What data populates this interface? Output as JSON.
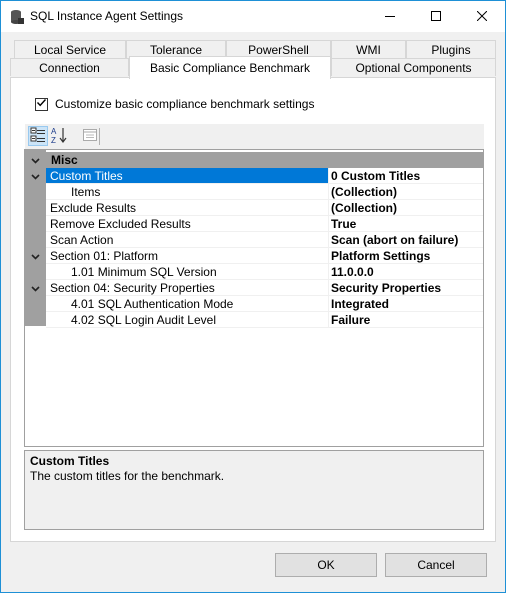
{
  "window": {
    "title": "SQL Instance Agent Settings"
  },
  "tabs": {
    "row1": [
      "Local Service",
      "Tolerance",
      "PowerShell",
      "WMI",
      "Plugins"
    ],
    "row2": [
      "Connection",
      "Basic Compliance Benchmark",
      "Optional Components"
    ],
    "active": "Basic Compliance Benchmark"
  },
  "checkbox": {
    "label": "Customize basic compliance benchmark settings",
    "checked": true
  },
  "toolbar": {
    "categorized": "categorized-icon",
    "alphabetical": "alphabetical-sort-icon",
    "property_pages": "property-pages-icon"
  },
  "grid": {
    "category": "Misc",
    "rows": [
      {
        "name": "Custom Titles",
        "value": "0 Custom Titles"
      },
      {
        "name": "Items",
        "value": "(Collection)"
      },
      {
        "name": "Exclude Results",
        "value": "(Collection)"
      },
      {
        "name": "Remove Excluded Results",
        "value": "True"
      },
      {
        "name": "Scan Action",
        "value": "Scan (abort on failure)"
      },
      {
        "name": "Section 01: Platform",
        "value": "Platform Settings"
      },
      {
        "name": "1.01 Minimum SQL Version",
        "value": "11.0.0.0"
      },
      {
        "name": "Section 04: Security Properties",
        "value": "Security Properties"
      },
      {
        "name": "4.01 SQL Authentication Mode",
        "value": "Integrated"
      },
      {
        "name": "4.02 SQL Login Audit Level",
        "value": "Failure"
      }
    ]
  },
  "help": {
    "title": "Custom Titles",
    "description": "The custom titles for the benchmark."
  },
  "buttons": {
    "ok": "OK",
    "cancel": "Cancel"
  },
  "colors": {
    "selection": "#0078d7",
    "category": "#a0a0a0",
    "window_border": "#1e90d6"
  }
}
